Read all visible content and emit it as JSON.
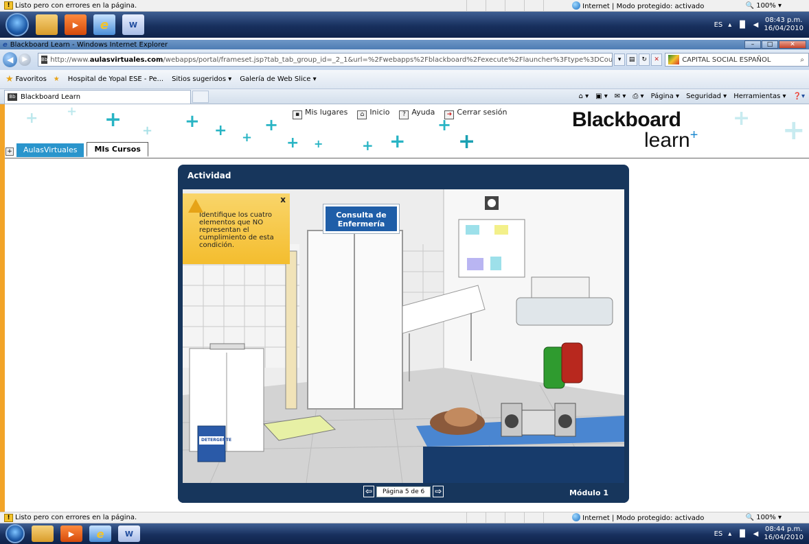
{
  "status_bar": {
    "message": "Listo pero con errores en la página.",
    "zone": "Internet | Modo protegido: activado",
    "zoom": "100%"
  },
  "taskbar": {
    "lang": "ES",
    "time": "08:43 p.m.",
    "date": "16/04/2010",
    "time_bottom": "08:44 p.m.",
    "date_bottom": "16/04/2010"
  },
  "browser": {
    "window_title": "Blackboard Learn - Windows Internet Explorer",
    "url_prefix": "http://www.",
    "url_domain": "aulasvirtuales.com",
    "url_rest": "/webapps/portal/frameset.jsp?tab_tab_group_id=_2_1&url=%2Fwebapps%2Fblackboard%2Fexecute%2Flauncher%3Ftype%3DCourse%26id%3D_1",
    "search_placeholder": "CAPITAL SOCIAL ESPAÑOL",
    "favorites_label": "Favoritos",
    "fav_items": [
      "Hospital de Yopal ESE - Pe...",
      "Sitios sugeridos ▾",
      "Galería de Web Slice ▾"
    ],
    "tab_title": "Blackboard Learn",
    "cmd": {
      "page": "Página ▾",
      "security": "Seguridad ▾",
      "tools": "Herramientas ▾"
    }
  },
  "bb": {
    "nav": [
      "Mis lugares",
      "Inicio",
      "Ayuda",
      "Cerrar sesión"
    ],
    "logo_top": "Blackboard",
    "logo_bottom": "learn",
    "tabs": [
      "AulasVirtuales",
      "MIs Cursos"
    ]
  },
  "activity": {
    "title": "Actividad",
    "instruction": "Identifique los cuatro elementos que NO representan el cumplimiento de esta condición.",
    "close": "x",
    "sign_line1": "Consulta de",
    "sign_line2": "Enfermería",
    "detergent": "DETERGENTE",
    "page": "Página 5 de 6",
    "module": "Módulo 1"
  }
}
